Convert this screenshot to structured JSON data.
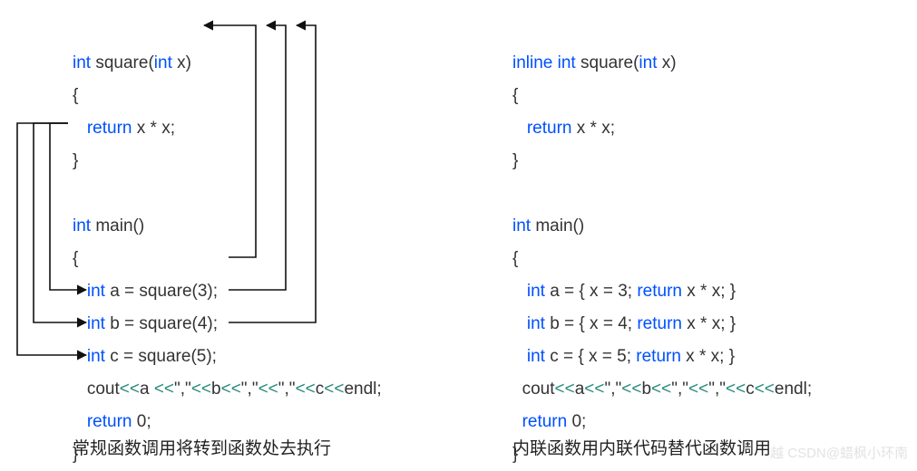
{
  "left": {
    "l1a": "int",
    "l1b": " square(",
    "l1c": "int",
    "l1d": " x)",
    "l2": "{",
    "l3a": "return",
    "l3b": " x * x;",
    "l4": "}",
    "l5a": "int",
    "l5b": " main()",
    "l6": "{",
    "l7a": "int",
    "l7b": " a = square(3);",
    "l8a": "int",
    "l8b": " b = square(4);",
    "l9a": "int",
    "l9b": " c = square(5);",
    "l10a": "cout",
    "l10g1": "<<",
    "l10b": "a ",
    "l10g2": "<<",
    "l10c": "\",\"",
    "l10g3": "<<",
    "l10d": "b",
    "l10g4": "<<",
    "l10e": "\",\"",
    "l10g5": "<<",
    "l10f": "\",\"",
    "l10g6": "<<",
    "l10g": "c",
    "l10g7": "<<",
    "l10h": "endl;",
    "l11a": "return",
    "l11b": " 0;",
    "l12": "}",
    "caption": "常规函数调用将转到函数处去执行"
  },
  "right": {
    "l1a": "inline int",
    "l1b": " square(",
    "l1c": "int",
    "l1d": " x)",
    "l2": "{",
    "l3a": "return",
    "l3b": " x * x;",
    "l4": "}",
    "l5a": "int",
    "l5b": " main()",
    "l6": "{",
    "l7a": "int",
    "l7b": " a = { x = 3; ",
    "l7c": "return",
    "l7d": " x * x; }",
    "l8a": "int",
    "l8b": " b = { x = 4; ",
    "l8c": "return",
    "l8d": " x * x; }",
    "l9a": "int",
    "l9b": " c = { x = 5; ",
    "l9c": "return",
    "l9d": " x * x; }",
    "l10a": "cout",
    "l10g1": "<<",
    "l10b": "a",
    "l10g2": "<<",
    "l10c": "\",\"",
    "l10g3": "<<",
    "l10d": "b",
    "l10g4": "<<",
    "l10e": "\",\"",
    "l10g5": "<<",
    "l10f": "\",\"",
    "l10g6": "<<",
    "l10g": "c",
    "l10g7": "<<",
    "l10h": "endl;",
    "l11a": "return",
    "l11b": " 0;",
    "l12": "}",
    "caption": "内联函数用内联代码替代函数调用"
  },
  "watermark": "越 CSDN@蜡枫小环南"
}
